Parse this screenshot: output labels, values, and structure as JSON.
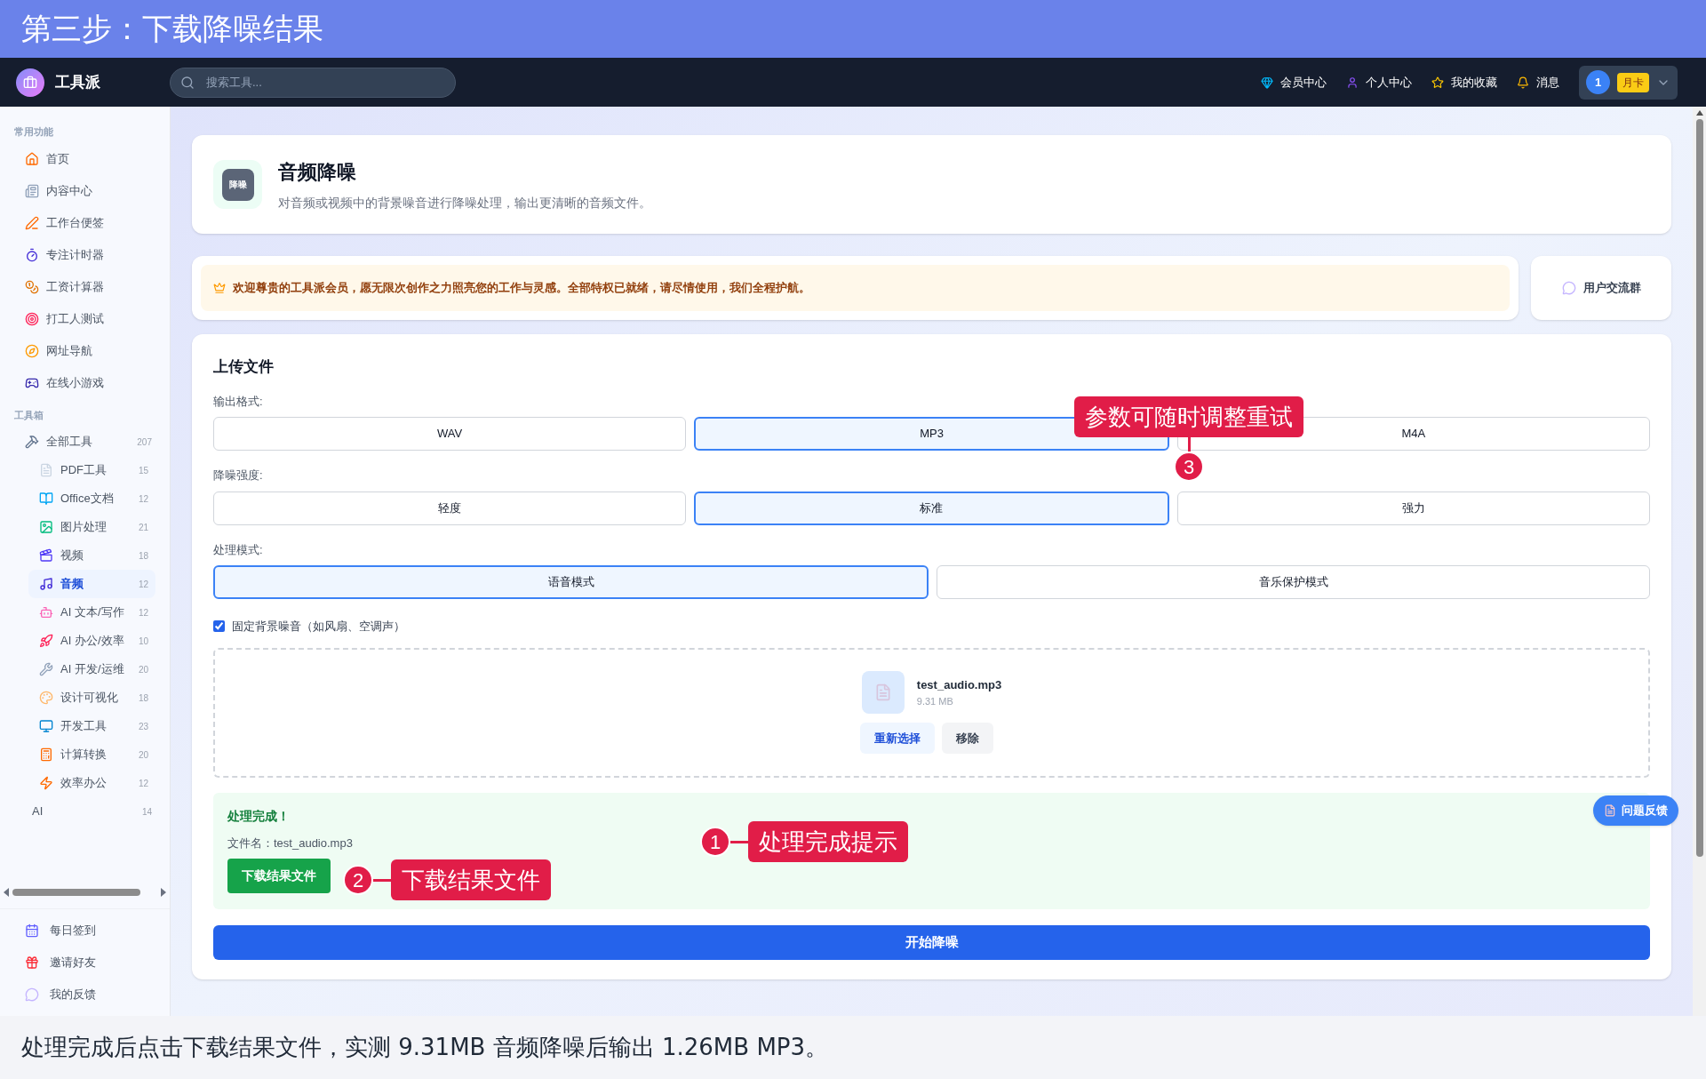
{
  "banner_title": "第三步：下载降噪结果",
  "header": {
    "logo": "工具派",
    "search": {
      "placeholder": "搜索工具..."
    },
    "nav": [
      {
        "label": "会员中心"
      },
      {
        "label": "个人中心"
      },
      {
        "label": "我的收藏"
      },
      {
        "label": "消息"
      }
    ],
    "user": {
      "avatar": "1",
      "badge": "月卡"
    }
  },
  "sidebar": {
    "sections": [
      {
        "title": "常用功能",
        "items": [
          {
            "label": "首页",
            "selected": false
          },
          {
            "label": "内容中心",
            "selected": false
          },
          {
            "label": "工作台便签",
            "selected": false
          },
          {
            "label": "专注计时器",
            "selected": false
          },
          {
            "label": "工资计算器",
            "selected": false
          },
          {
            "label": "打工人测试",
            "selected": false
          },
          {
            "label": "网址导航",
            "selected": false
          },
          {
            "label": "在线小游戏",
            "selected": false
          }
        ]
      },
      {
        "title": "工具箱",
        "items": [
          {
            "label": "全部工具",
            "count": "207",
            "selected": false,
            "children": [
              {
                "label": "PDF工具",
                "count": "15",
                "selected": false
              },
              {
                "label": "Office文档",
                "count": "12",
                "selected": false
              },
              {
                "label": "图片处理",
                "count": "21",
                "selected": false
              },
              {
                "label": "视频",
                "count": "18",
                "selected": false
              },
              {
                "label": "音频",
                "count": "12",
                "selected": true
              },
              {
                "label": "AI 文本/写作",
                "count": "12",
                "selected": false
              },
              {
                "label": "AI 办公/效率",
                "count": "10",
                "selected": false
              },
              {
                "label": "AI 开发/运维",
                "count": "20",
                "selected": false
              },
              {
                "label": "设计可视化",
                "count": "18",
                "selected": false
              },
              {
                "label": "开发工具",
                "count": "23",
                "selected": false
              },
              {
                "label": "计算转换",
                "count": "20",
                "selected": false
              },
              {
                "label": "效率办公",
                "count": "12",
                "selected": false
              }
            ]
          },
          {
            "label": "AI",
            "count": "14",
            "selected": false
          }
        ]
      }
    ],
    "footer_items": [
      {
        "label": "每日签到"
      },
      {
        "label": "邀请好友"
      },
      {
        "label": "我的反馈"
      }
    ]
  },
  "tool": {
    "icon_text": "降噪",
    "title": "音频降噪",
    "description": "对音频或视频中的背景噪音进行降噪处理，输出更清晰的音频文件。"
  },
  "notice": "欢迎尊贵的工具派会员，愿无限次创作之力照亮您的工作与灵感。全部特权已就绪，请尽情使用，我们全程护航。",
  "community_button": "用户交流群",
  "upload": {
    "title": "上传文件",
    "groups": [
      {
        "label": "输出格式:",
        "options": [
          {
            "label": "WAV",
            "selected": false
          },
          {
            "label": "MP3",
            "selected": true
          },
          {
            "label": "M4A",
            "selected": false
          }
        ]
      },
      {
        "label": "降噪强度:",
        "options": [
          {
            "label": "轻度",
            "selected": false
          },
          {
            "label": "标准",
            "selected": true
          },
          {
            "label": "强力",
            "selected": false
          }
        ]
      },
      {
        "label": "处理模式:",
        "options": [
          {
            "label": "语音模式",
            "selected": true
          },
          {
            "label": "音乐保护模式",
            "selected": false
          }
        ]
      }
    ],
    "checkbox": {
      "label": "固定背景噪音（如风扇、空调声）",
      "checked": true
    },
    "file": {
      "name": "test_audio.mp3",
      "size": "9.31 MB",
      "buttons": [
        "重新选择",
        "移除"
      ]
    },
    "result": {
      "title": "处理完成！",
      "filename": "文件名：test_audio.mp3",
      "download": "下载结果文件"
    },
    "start_button": "开始降噪"
  },
  "annotations": [
    {
      "number": "1",
      "label": "处理完成提示"
    },
    {
      "number": "2",
      "label": "下载结果文件"
    },
    {
      "number": "3",
      "label": "参数可随时调整重试"
    }
  ],
  "feedback_button": "问题反馈",
  "caption": "处理完成后点击下载结果文件，实测 9.31MB 音频降噪后输出 1.26MB MP3。"
}
